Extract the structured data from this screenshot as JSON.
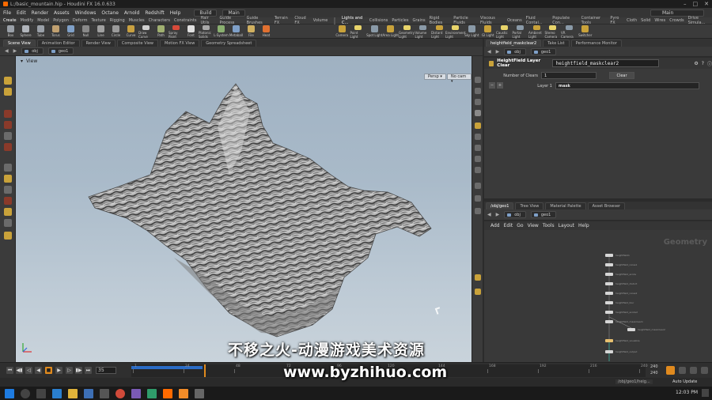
{
  "window": {
    "title": "L:/basic_mountain.hip - Houdini FX 16.0.633",
    "desktop": "Build",
    "main_desk": "Main",
    "right_desk": "Main"
  },
  "menu": [
    "File",
    "Edit",
    "Render",
    "Assets",
    "Windows",
    "Octane",
    "Arnold",
    "Redshift",
    "Help"
  ],
  "shelf_tabs_left": [
    "Create",
    "Modify",
    "Model",
    "Polygon",
    "Deform",
    "Texture",
    "Rigging",
    "Muscles",
    "Characters",
    "Constraints",
    "Hair Utils",
    "Guide Process",
    "Guide Brushes",
    "Terrain FX",
    "Cloud FX",
    "Volume"
  ],
  "shelf_tabs_right": [
    "Lights and C...",
    "Collisions",
    "Particles",
    "Grains",
    "Rigid Bodies",
    "Particle Fluids",
    "Viscous Fluids",
    "Oceans",
    "Fluid Contai...",
    "Populate Con...",
    "Container Tools",
    "Pyro FX",
    "Cloth",
    "Solid",
    "Wires",
    "Crowds",
    "Drive Simula..."
  ],
  "shelf_tools_left": [
    "Box",
    "Sphere",
    "Tube",
    "Torus",
    "Grid",
    "Null",
    "Line",
    "Circle",
    "Curve",
    "Draw Curve",
    "Path",
    "Spray Paint",
    "Font",
    "Platonic Solids",
    "L-System",
    "Metaball",
    "File",
    "Heat"
  ],
  "shelf_tools_right": [
    "Camera",
    "Point Light",
    "Spot Light",
    "Area Light",
    "Geometry Light",
    "Volume Light",
    "Distant Light",
    "Environment Light",
    "Sky Light",
    "GI Light",
    "Caustic Light",
    "Portal Light",
    "Ambient Light",
    "Stereo Camera",
    "VR Camera",
    "Switcher"
  ],
  "left_tabs": [
    "Scene View",
    "Animation Editor",
    "Render View",
    "Composite View",
    "Motion FX View",
    "Geometry Spreadsheet"
  ],
  "path": {
    "root": "obj",
    "node": "geo1"
  },
  "viewport": {
    "label": "View",
    "persp_btn": "Persp ▾",
    "cam_btn": "No cam ▾"
  },
  "param_tabs": [
    "heightfield_maskclear2",
    "Take List",
    "Performance Monitor"
  ],
  "param": {
    "node_type": "HeightField Layer Clear",
    "node_name": "heightfield_maskclear2",
    "num_clears_label": "Number of Clears",
    "num_clears_value": "1",
    "clear_button": "Clear",
    "layer_label": "Layer 1",
    "layer_value": "mask"
  },
  "net_tabs": [
    "/obj/geo1",
    "Tree View",
    "Material Palette",
    "Asset Browser"
  ],
  "net_menu": [
    "Add",
    "Edit",
    "Go",
    "View",
    "Tools",
    "Layout",
    "Help"
  ],
  "net_context_label": "Geometry",
  "network_nodes": [
    "heightfield1",
    "heightfield_noise1",
    "heightfield_erode",
    "heightfield_distort",
    "heightfield_noise2",
    "heightfield_blur",
    "heightfield_erode2",
    "heightfield_maskclear1",
    "heightfield_maskclear2",
    "heightfield_visualize",
    "heightfield_output"
  ],
  "timeline": {
    "current_frame": "35",
    "ticks": [
      "1",
      "24",
      "48",
      "72",
      "96",
      "120",
      "144",
      "168",
      "192",
      "216",
      "240"
    ],
    "end_frame_top": "240",
    "end_frame_bottom": "240"
  },
  "status": {
    "jobs_label": "/obj/geo1/heig...",
    "update_mode": "Auto Update"
  },
  "taskbar": {
    "time": "12:03 PM"
  },
  "watermark": {
    "cn": "不移之火-动漫游戏美术资源",
    "url": "www.byzhihuo.com"
  },
  "colors": {
    "accent": "#ff6a00",
    "selection": "#2b6cc6",
    "viewport_top": "#9fb1c2",
    "viewport_bottom": "#c9d3db"
  }
}
